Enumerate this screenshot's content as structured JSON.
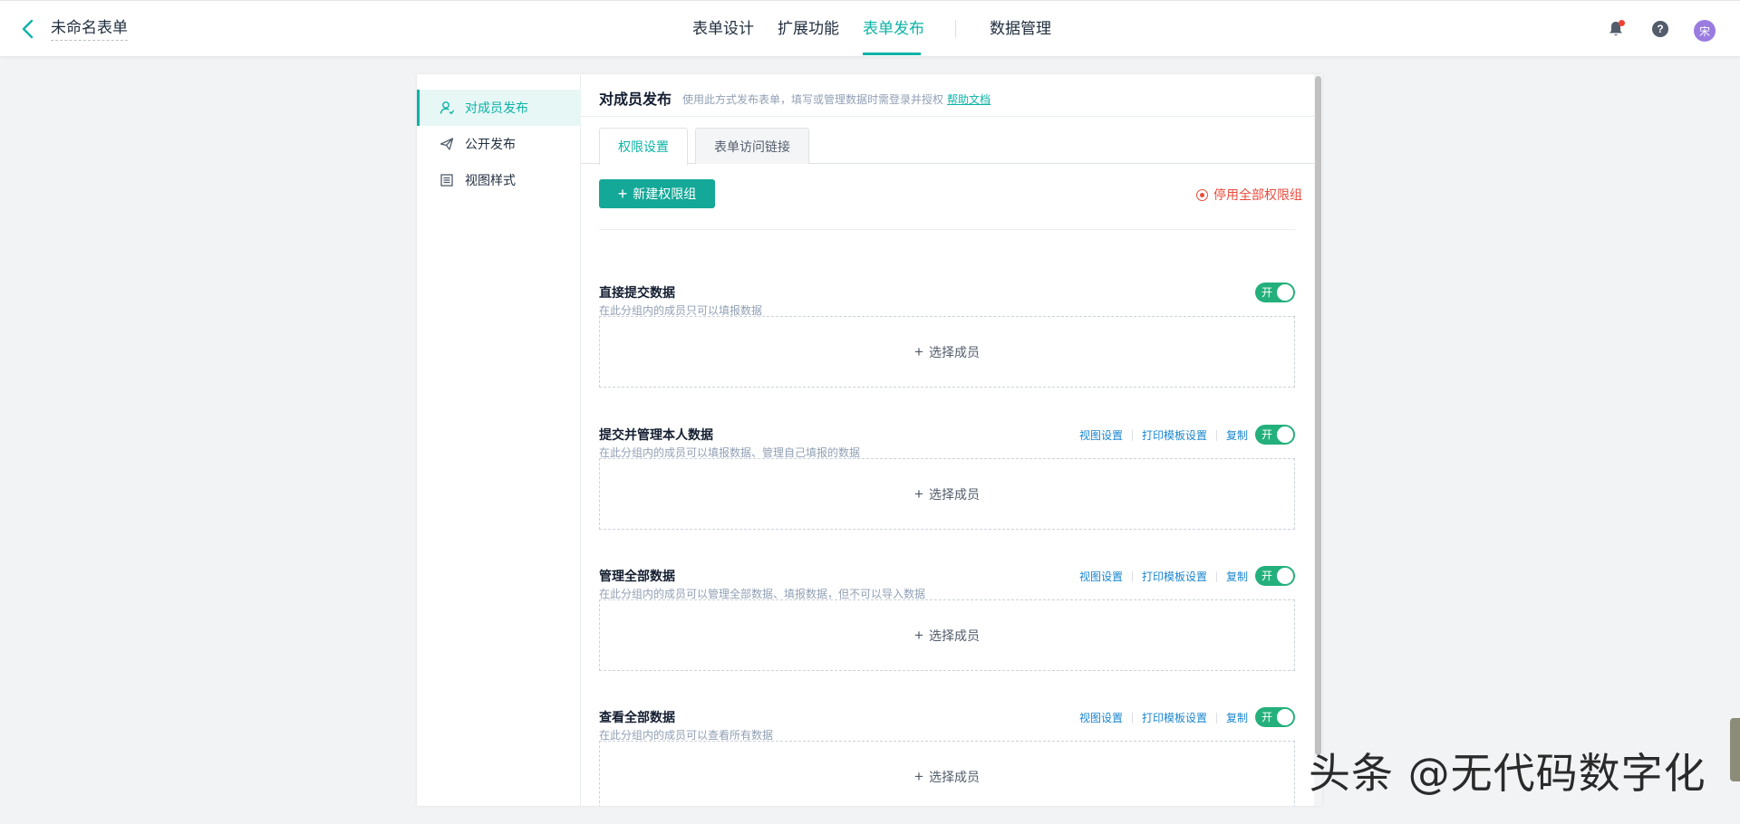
{
  "header": {
    "form_name": "未命名表单",
    "nav": [
      "表单设计",
      "扩展功能",
      "表单发布",
      "数据管理"
    ],
    "active_nav": "表单发布",
    "avatar_text": "宋",
    "help_glyph": "?"
  },
  "sidebar": {
    "items": [
      {
        "label": "对成员发布",
        "icon": "member-publish-icon",
        "active": true
      },
      {
        "label": "公开发布",
        "icon": "paper-plane-icon",
        "active": false
      },
      {
        "label": "视图样式",
        "icon": "list-view-icon",
        "active": false
      }
    ]
  },
  "content": {
    "title": "对成员发布",
    "description": "使用此方式发布表单，填写或管理数据时需登录并授权",
    "help_link": "帮助文档",
    "tabs": [
      "权限设置",
      "表单访问链接"
    ],
    "active_tab": "权限设置",
    "new_group_button": "新建权限组",
    "disable_all": "停用全部权限组",
    "groups": [
      {
        "title": "直接提交数据",
        "desc": "在此分组内的成员只可以填报数据",
        "actions": [],
        "toggle": "开",
        "select": "选择成员"
      },
      {
        "title": "提交并管理本人数据",
        "desc": "在此分组内的成员可以填报数据、管理自己填报的数据",
        "actions": [
          "视图设置",
          "打印模板设置",
          "复制"
        ],
        "toggle": "开",
        "select": "选择成员"
      },
      {
        "title": "管理全部数据",
        "desc": "在此分组内的成员可以管理全部数据、填报数据，但不可以导入数据",
        "actions": [
          "视图设置",
          "打印模板设置",
          "复制"
        ],
        "toggle": "开",
        "select": "选择成员"
      },
      {
        "title": "查看全部数据",
        "desc": "在此分组内的成员可以查看所有数据",
        "actions": [
          "视图设置",
          "打印模板设置",
          "复制"
        ],
        "toggle": "开",
        "select": "选择成员"
      }
    ]
  },
  "watermark": "头条 @无代码数字化",
  "colors": {
    "accent": "#0db3a6",
    "button": "#14a898",
    "toggle_on": "#24b07c",
    "danger": "#e84b3c",
    "link": "#1a86d0"
  }
}
